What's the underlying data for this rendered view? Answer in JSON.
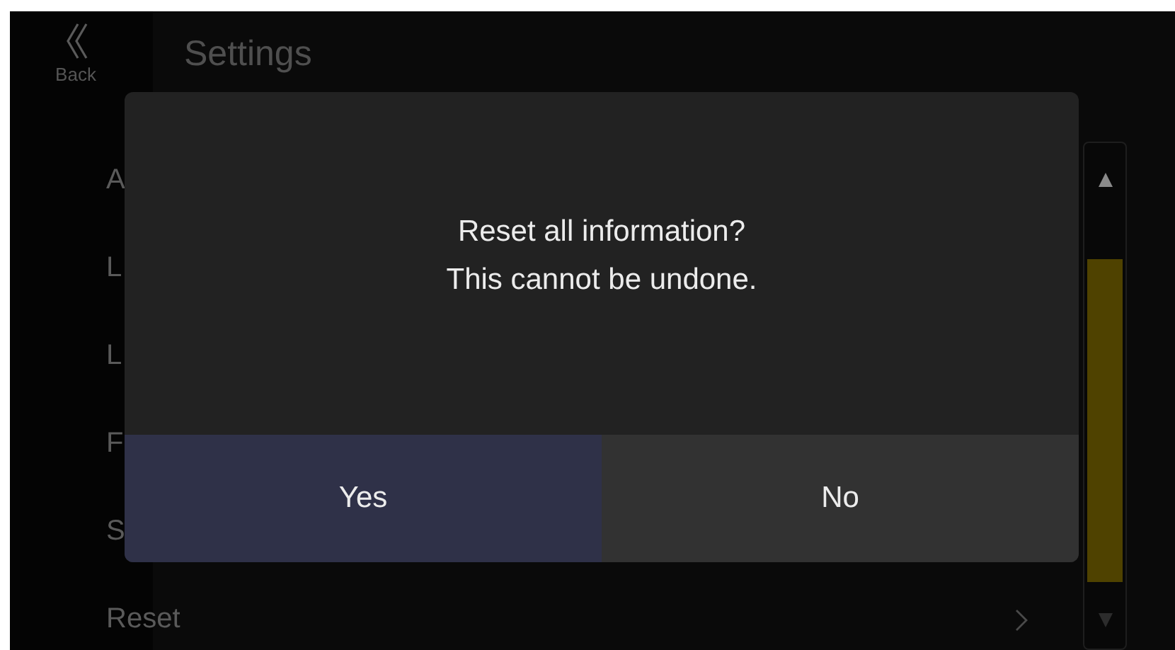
{
  "sidebar": {
    "back_label": "Back"
  },
  "header": {
    "title": "Settings"
  },
  "settings_rows": [
    {
      "label": "A"
    },
    {
      "label": "L"
    },
    {
      "label": "L"
    },
    {
      "label": "F"
    },
    {
      "label": "S"
    },
    {
      "label": "Reset",
      "chevron": true
    }
  ],
  "dialog": {
    "message_lines": [
      "Reset all information?",
      "This cannot be undone."
    ],
    "buttons": [
      {
        "label": "Yes",
        "selected": true
      },
      {
        "label": "No",
        "selected": false
      }
    ]
  }
}
